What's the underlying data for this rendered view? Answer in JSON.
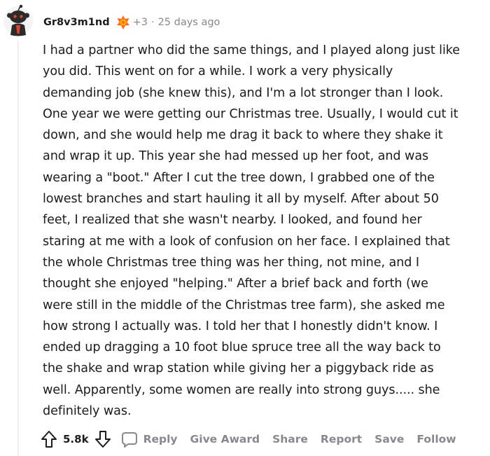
{
  "comment": {
    "username": "Gr8v3m1nd",
    "karma": "+3",
    "separator": "·",
    "timestamp": "25 days ago",
    "body_lines": [
      "I had a partner who did the same things, and I played along just like",
      "you did. This went on for a while. I work a very physically",
      "demanding job (she knew this), and I'm a lot stronger than I look.",
      "One year we were getting our Christmas tree. Usually, I would cut it",
      "down, and she would help me drag it back to where they shake it",
      "and wrap it up. This year she had messed up her foot, and was",
      "wearing a \"boot.\" After I cut the tree down, I grabbed one of the",
      "lowest branches and start hauling it all by myself. After about 50",
      "feet, I realized that she wasn't nearby. I looked, and found her",
      "staring at me with a look of confusion on her face. I explained that",
      "the whole Christmas tree thing was her thing, not mine, and I",
      "thought she enjoyed \"helping.\" After a brief back and forth (we",
      "were still in the middle of the Christmas tree farm), she asked me",
      "how strong I actually was. I told her that I honestly didn't know. I",
      "ended up dragging a 10 foot blue spruce tree all the way back to",
      "the shake and wrap station while giving her a piggyback ride as",
      "well. Apparently, some women are really into strong guys..... she",
      "definitely was."
    ]
  },
  "actions": {
    "score": "5.8k",
    "reply": "Reply",
    "give_award": "Give Award",
    "share": "Share",
    "report": "Report",
    "save": "Save",
    "follow": "Follow"
  },
  "icons": {
    "avatar": "snoo-avatar-icon",
    "flair": "award-flair-icon",
    "upvote": "upvote-arrow-icon",
    "downvote": "downvote-arrow-icon",
    "reply": "comment-bubble-icon"
  },
  "colors": {
    "text": "#1c1c1c",
    "meta": "#878a8c",
    "avatar_dark": "#2b2b2b",
    "avatar_accent": "#e0452b",
    "flair": "#ff6a1a"
  }
}
